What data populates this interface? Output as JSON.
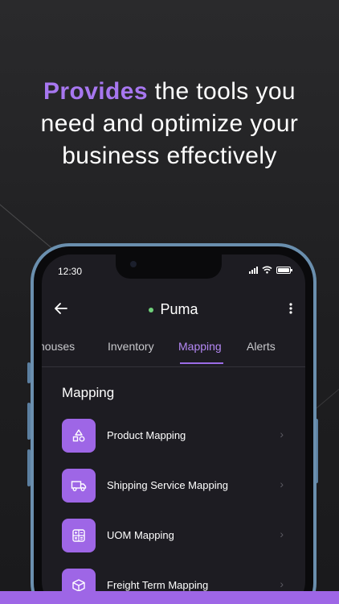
{
  "headline": {
    "accent": "Provides",
    "line1_rest": " the tools you",
    "line2": "need and optimize your",
    "line3": "business effectively"
  },
  "status_bar": {
    "time": "12:30"
  },
  "header": {
    "title": "Puma",
    "status_color": "#6fd07a"
  },
  "tabs": [
    {
      "label": "houses"
    },
    {
      "label": "Inventory"
    },
    {
      "label": "Mapping",
      "active": true
    },
    {
      "label": "Alerts"
    }
  ],
  "section": {
    "title": "Mapping"
  },
  "items": [
    {
      "label": "Product Mapping",
      "icon": "shapes-icon"
    },
    {
      "label": "Shipping Service Mapping",
      "icon": "truck-icon"
    },
    {
      "label": "UOM Mapping",
      "icon": "calculator-icon"
    },
    {
      "label": "Freight Term Mapping",
      "icon": "box-icon"
    }
  ],
  "colors": {
    "accent": "#a777f0",
    "icon_bg": "#9e66e6"
  }
}
